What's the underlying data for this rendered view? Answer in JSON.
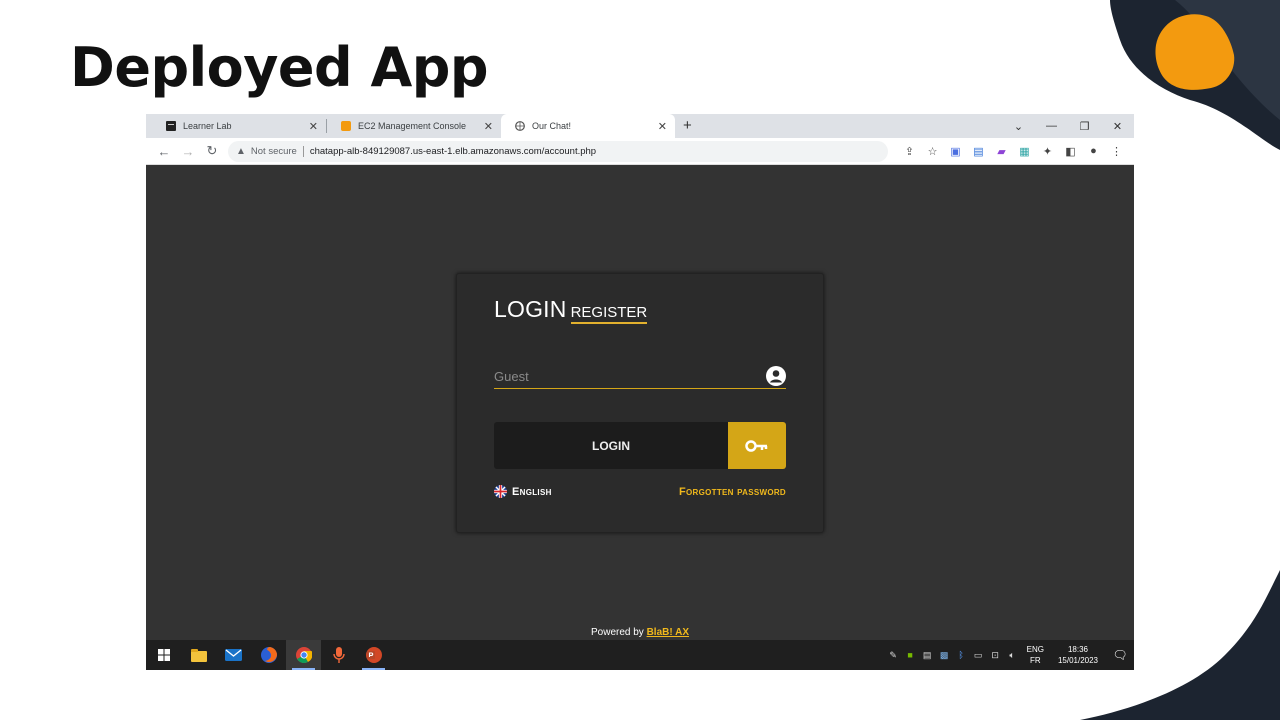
{
  "slide": {
    "title": "Deployed App"
  },
  "browser": {
    "tabs": [
      {
        "label": "Learner Lab",
        "icon": "terminal-icon"
      },
      {
        "label": "EC2 Management Console",
        "icon": "aws-icon"
      },
      {
        "label": "Our Chat!",
        "icon": "globe-icon"
      }
    ],
    "new_tab": "+",
    "address": {
      "security": "Not secure",
      "url": "chatapp-alb-849129087.us-east-1.elb.amazonaws.com/account.php"
    }
  },
  "app": {
    "tab_login": "LOGIN",
    "tab_register": "REGISTER",
    "username_placeholder": "Guest",
    "login_button": "LOGIN",
    "language": "English",
    "forgot_password": "Forgotten password",
    "powered_prefix": "Powered by",
    "powered_brand": "BlaB! AX",
    "accent_color": "#d4a617"
  },
  "taskbar": {
    "lang_top": "ENG",
    "lang_bottom": "FR",
    "time": "18:36",
    "date": "15/01/2023"
  }
}
